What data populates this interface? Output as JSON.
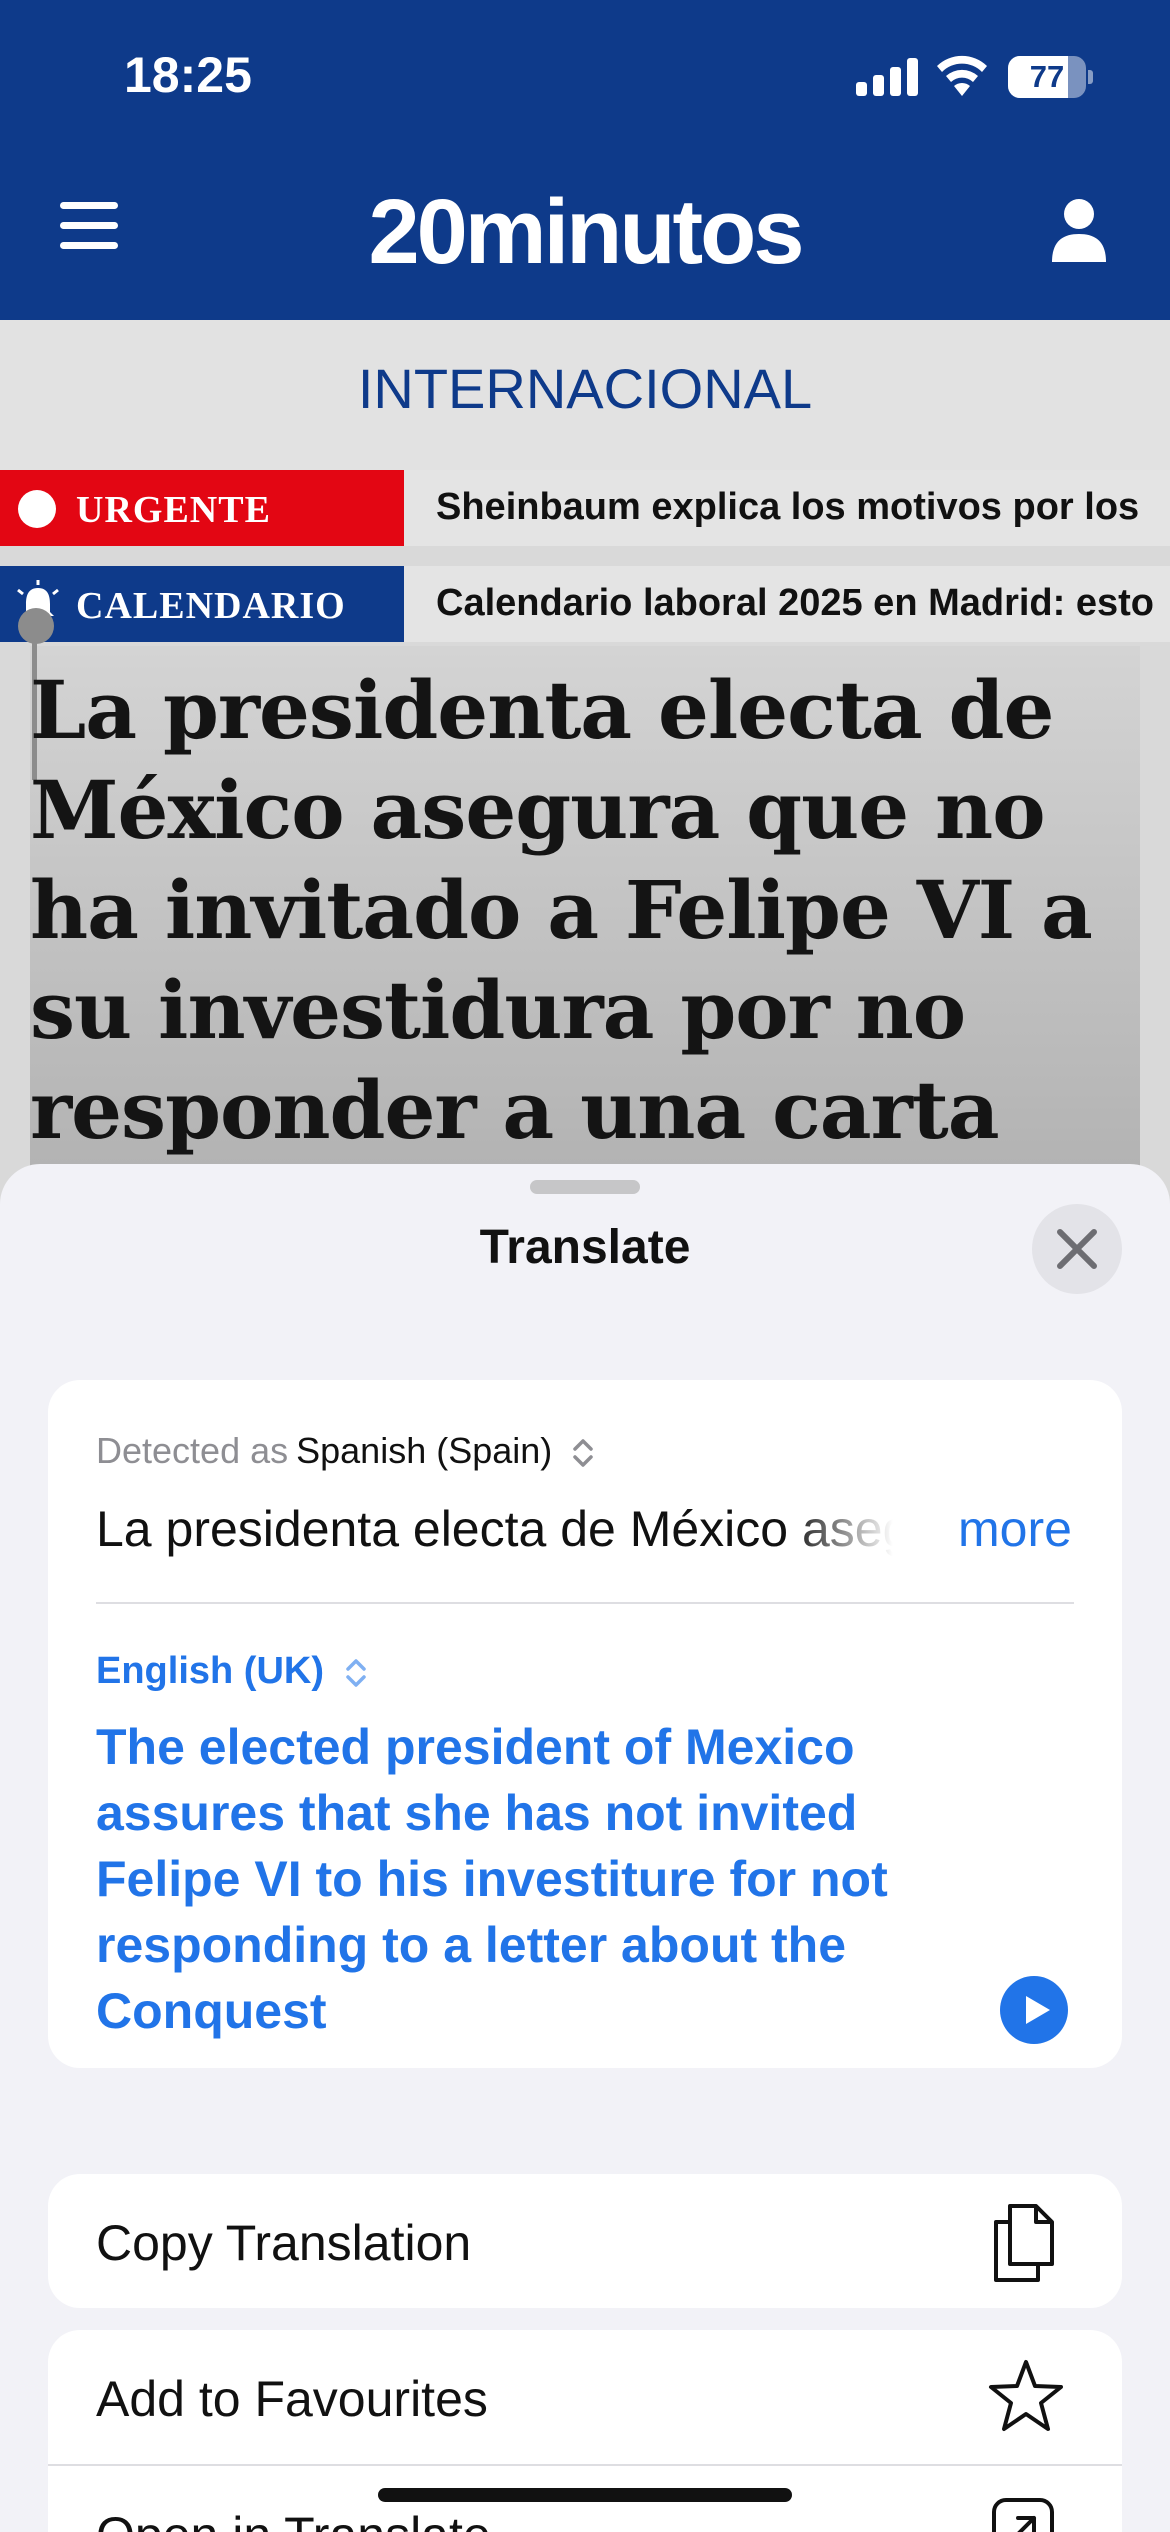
{
  "status_bar": {
    "time": "18:25",
    "battery": "77",
    "battery_level": 0.77,
    "icons": [
      "cellular-signal-icon",
      "wifi-icon",
      "battery-icon"
    ]
  },
  "header": {
    "logo": "20minutos",
    "menu_icon": "hamburger-menu-icon",
    "account_icon": "user-icon",
    "background": "#0e3a8a"
  },
  "section": {
    "title": "INTERNACIONAL"
  },
  "tickers": [
    {
      "tag": "URGENTE",
      "text": "Sheinbaum explica los motivos por los",
      "tag_color": "#e30613",
      "icon": "live-dot-icon"
    },
    {
      "tag": "CALENDARIO",
      "text": "Calendario laboral 2025 en Madrid: esto",
      "tag_color": "#0e3a8a",
      "icon": "bell-icon"
    }
  ],
  "article": {
    "headline": "La presidenta electa de México asegura que no ha invitado a Felipe VI a su investidura por no responder a una carta"
  },
  "translate_sheet": {
    "title": "Translate",
    "detected_prefix": "Detected as",
    "detected_language": "Spanish (Spain)",
    "source_text": "La presidenta electa de México asegura",
    "more_label": "more",
    "target_language": "English (UK)",
    "translation": "The elected president of Mexico assures that she has not invited Felipe VI to his investiture for not responding to a letter about the Conquest",
    "accent": "#2174e8",
    "actions": [
      {
        "label": "Copy Translation",
        "icon": "copy-icon"
      },
      {
        "label": "Add to Favourites",
        "icon": "star-icon"
      },
      {
        "label": "Open in Translate",
        "icon": "open-external-icon"
      }
    ]
  }
}
